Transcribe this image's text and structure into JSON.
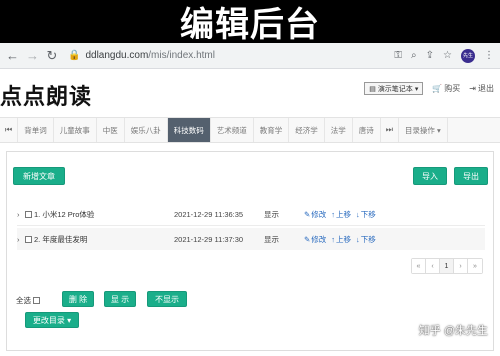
{
  "banner": {
    "title": "编辑后台"
  },
  "browser": {
    "url_host": "ddlangdu.com",
    "url_path": "/mis/index.html",
    "avatar_text": "先生"
  },
  "header": {
    "logo_text": "点点朗读",
    "notebook_label": "演示笔记本",
    "buy_label": "购买",
    "logout_label": "退出"
  },
  "categories": {
    "items": [
      "背单词",
      "儿童故事",
      "中医",
      "娱乐八卦",
      "科技数码",
      "艺术频道",
      "教育学",
      "经济学",
      "法学",
      "唐诗"
    ],
    "active_index": 4,
    "catalog_ops_label": "目录操作"
  },
  "toolbar": {
    "new_article_label": "新增文章",
    "import_label": "导入",
    "export_label": "导出"
  },
  "articles": [
    {
      "title": "1. 小米12 Pro体验",
      "date": "2021-12-29 11:36:35",
      "state": "显示"
    },
    {
      "title": "2. 年度最佳发明",
      "date": "2021-12-29 11:37:30",
      "state": "显示"
    }
  ],
  "row_ops": {
    "edit": "修改",
    "up": "上移",
    "down": "下移"
  },
  "pagination": {
    "first": "«",
    "prev": "‹",
    "current": "1",
    "next": "›",
    "last": "»"
  },
  "bulk": {
    "select_all_label": "全选",
    "delete_label": "删 除",
    "show_label": "显 示",
    "hide_label": "不显示",
    "change_catalog_label": "更改目录"
  },
  "watermark": "知乎 @朱先生",
  "colors": {
    "accent": "#1aae8a",
    "active_tab": "#54606e",
    "link": "#2a6bbf"
  }
}
